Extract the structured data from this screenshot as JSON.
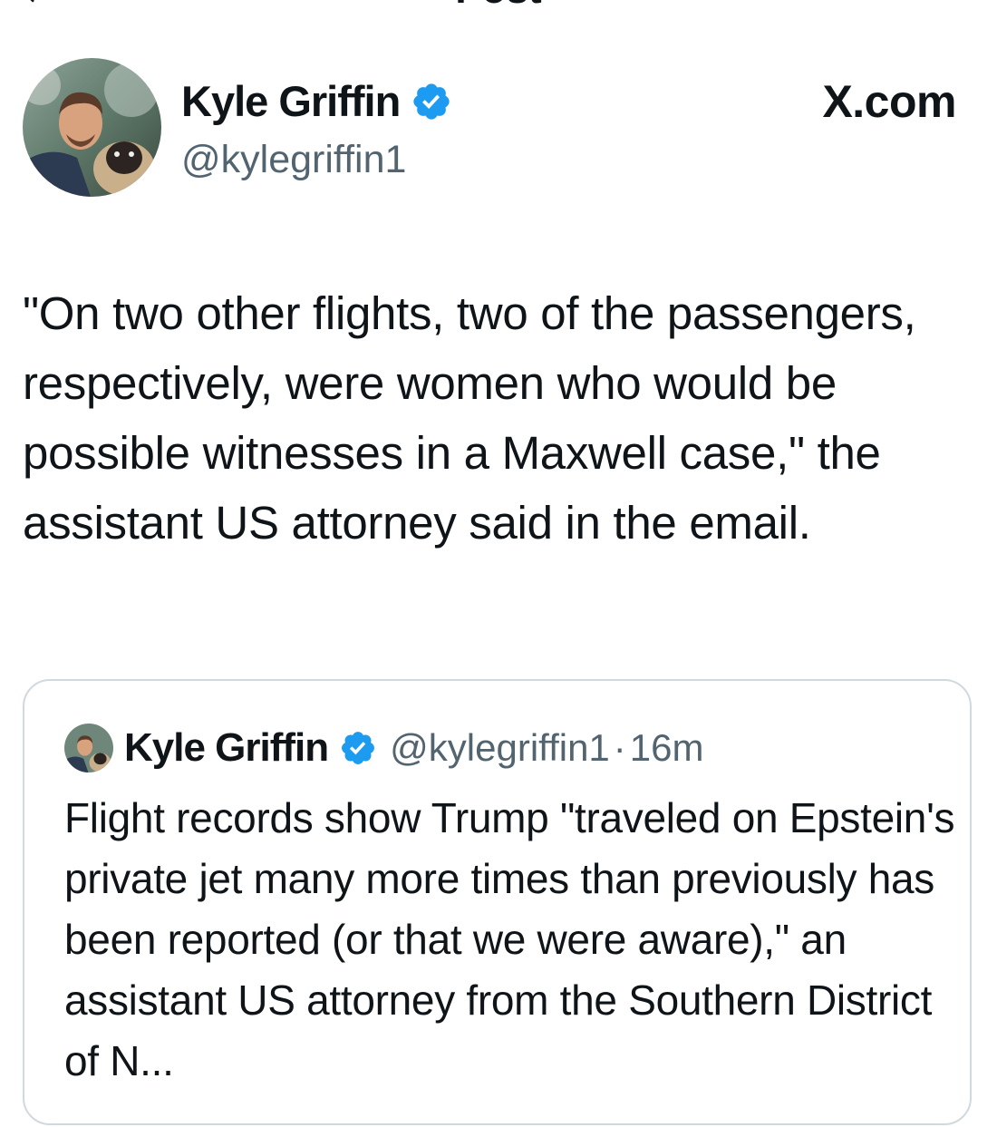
{
  "topbar": {
    "title": "Post"
  },
  "post": {
    "author_name": "Kyle Griffin",
    "author_handle": "@kylegriffin1",
    "site_label": "X.com",
    "text": "\"On two other flights, two of the passengers, respectively, were women who would be possible witnesses in a Maxwell case,\" the assistant US attorney said in the email."
  },
  "quoted_post": {
    "author_name": "Kyle Griffin",
    "author_handle": "@kylegriffin1",
    "separator": "·",
    "time": "16m",
    "text": "Flight records show Trump \"traveled on Epstein's private jet many more times than previously has been reported (or that we were aware),\" an assistant US attorney from the Southern District of N..."
  },
  "colors": {
    "verified": "#1d9bf0",
    "secondary_text": "#536471",
    "primary_text": "#0f1419",
    "border": "#cfd9de"
  },
  "icons": {
    "back": "arrow-left-icon",
    "verified": "verified-badge-icon"
  }
}
